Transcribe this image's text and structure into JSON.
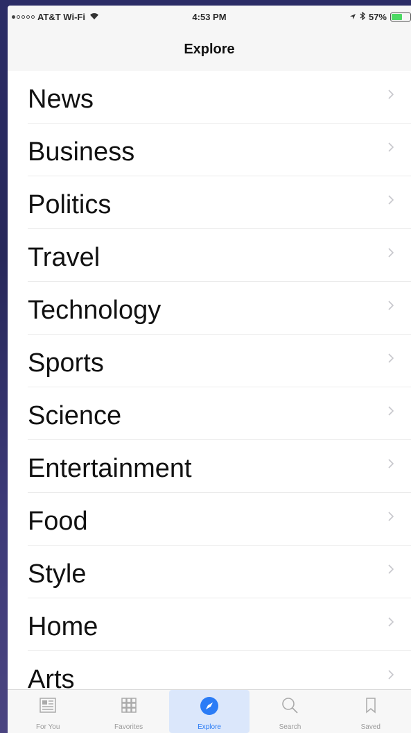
{
  "status_bar": {
    "carrier": "AT&T Wi-Fi",
    "time": "4:53 PM",
    "battery": "57%",
    "battery_level": 0.57
  },
  "nav": {
    "title": "Explore"
  },
  "categories": [
    "News",
    "Business",
    "Politics",
    "Travel",
    "Technology",
    "Sports",
    "Science",
    "Entertainment",
    "Food",
    "Style",
    "Home",
    "Arts"
  ],
  "tabs": [
    {
      "label": "For You",
      "icon": "for-you-icon",
      "active": false
    },
    {
      "label": "Favorites",
      "icon": "favorites-grid-icon",
      "active": false
    },
    {
      "label": "Explore",
      "icon": "compass-icon",
      "active": true
    },
    {
      "label": "Search",
      "icon": "search-icon",
      "active": false
    },
    {
      "label": "Saved",
      "icon": "bookmark-icon",
      "active": false
    }
  ],
  "colors": {
    "accent": "#2a7cf6",
    "battery": "#4cd964"
  }
}
